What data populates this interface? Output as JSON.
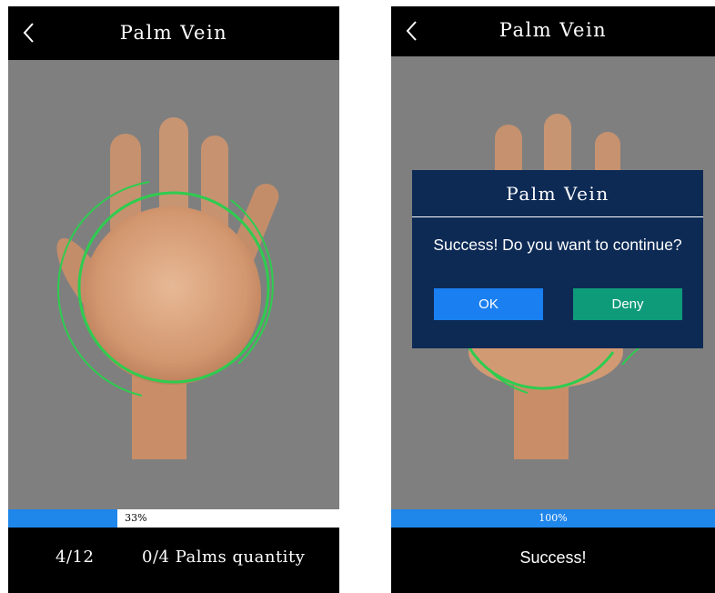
{
  "colors": {
    "header_bg": "#000000",
    "camera_bg": "#7f7f7f",
    "progress_fill": "#1f86ea",
    "scan_ring": "#2ecc4f",
    "dialog_bg": "#0d2a55",
    "ok_button": "#1a7ff0",
    "deny_button": "#0e9b7a"
  },
  "screens": [
    {
      "header": {
        "back_icon": "chevron-left-icon",
        "title": "Palm Vein"
      },
      "progress": {
        "value": 0.33,
        "label": "33%"
      },
      "footer": {
        "counter": "4/12",
        "palms_quantity": "0/4 Palms quantity"
      }
    },
    {
      "header": {
        "back_icon": "chevron-left-icon",
        "title": "Palm Vein"
      },
      "progress": {
        "value": 1.0,
        "label": "100%"
      },
      "footer": {
        "status": "Success!"
      },
      "dialog": {
        "title": "Palm Vein",
        "message": "Success! Do you want to continue?",
        "ok_label": "OK",
        "deny_label": "Deny"
      }
    }
  ]
}
